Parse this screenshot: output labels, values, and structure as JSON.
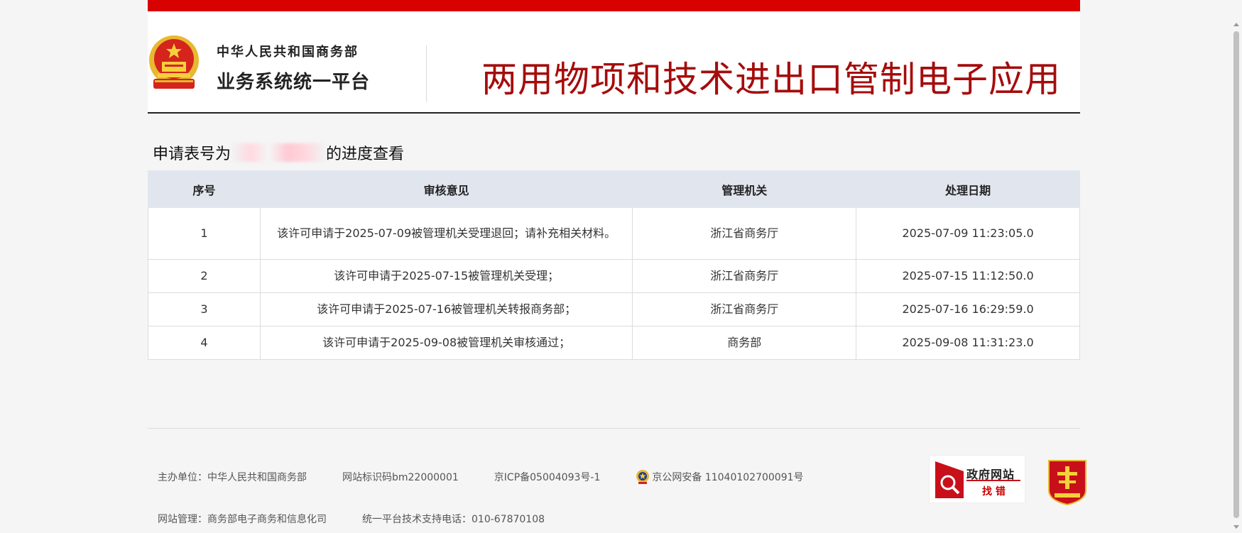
{
  "header": {
    "org_name": "中华人民共和国商务部",
    "platform_name": "业务系统统一平台",
    "app_title": "两用物项和技术进出口管制电子应用",
    "emblem_icon": "national-emblem-icon"
  },
  "progress": {
    "heading_prefix": "申请表号为",
    "heading_suffix": "的进度查看",
    "columns": [
      "序号",
      "审核意见",
      "管理机关",
      "处理日期"
    ],
    "rows": [
      {
        "no": "1",
        "opinion": "该许可申请于2025-07-09被管理机关受理退回；请补充相关材料。",
        "org": "浙江省商务厅",
        "date": "2025-07-09 11:23:05.0"
      },
      {
        "no": "2",
        "opinion": "该许可申请于2025-07-15被管理机关受理；",
        "org": "浙江省商务厅",
        "date": "2025-07-15 11:12:50.0"
      },
      {
        "no": "3",
        "opinion": "该许可申请于2025-07-16被管理机关转报商务部；",
        "org": "浙江省商务厅",
        "date": "2025-07-16 16:29:59.0"
      },
      {
        "no": "4",
        "opinion": "该许可申请于2025-09-08被管理机关审核通过；",
        "org": "商务部",
        "date": "2025-09-08 11:31:23.0"
      }
    ]
  },
  "footer": {
    "sponsor": "主办单位：中华人民共和国商务部",
    "site_code": "网站标识码bm22000001",
    "icp": "京ICP备05004093号-1",
    "police_record": "京公网安备 11040102700091号",
    "site_manager": "网站管理：商务部电子商务和信息化司",
    "support_phone": "统一平台技术支持电话：010-67870108",
    "gov_badge_title": "政府网站",
    "gov_badge_sub": "找 错",
    "gov_badge_icon": "gov-website-error-report-icon",
    "party_badge_icon": "party-government-organ-badge-icon",
    "police_icon": "public-security-badge-icon"
  },
  "colors": {
    "top_bar": "#d90000",
    "app_title": "#a50c0c",
    "table_header_bg": "#e1e6ee"
  }
}
